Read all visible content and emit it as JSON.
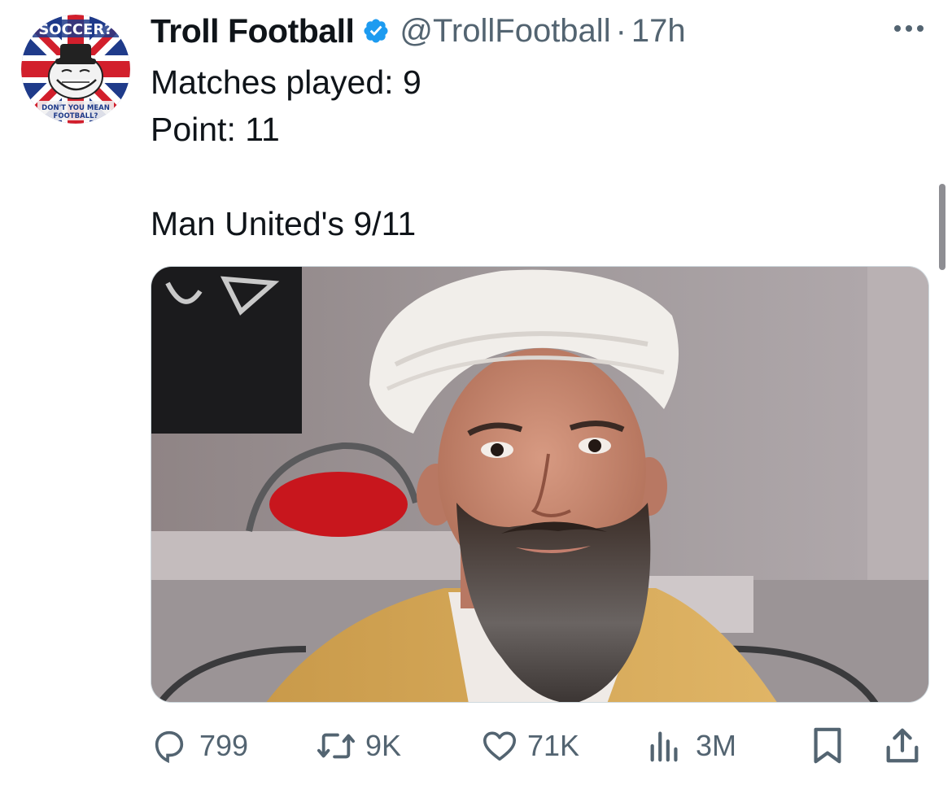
{
  "tweet": {
    "author": {
      "display_name": "Troll Football",
      "handle": "@TrollFootball",
      "verified": true,
      "avatar": {
        "icon": "troll-face-union-jack-avatar",
        "text_top": "SOCCER?",
        "text_bottom_1": "DON'T YOU MEAN",
        "text_bottom_2": "FOOTBALL?"
      }
    },
    "separator": "·",
    "time": "17h",
    "more_icon": "more-horizontal-icon",
    "text_lines": [
      "Matches played: 9",
      "Point: 11",
      "",
      "Man United's 9/11"
    ],
    "media": {
      "description_icon": "photo-edited-man-turban-beard"
    },
    "actions": {
      "replies": {
        "icon": "reply-icon",
        "count": "799"
      },
      "retweets": {
        "icon": "retweet-icon",
        "count": "9K"
      },
      "likes": {
        "icon": "heart-icon",
        "count": "71K"
      },
      "views": {
        "icon": "views-icon",
        "count": "3M"
      },
      "bookmark": {
        "icon": "bookmark-icon"
      },
      "share": {
        "icon": "share-icon"
      }
    },
    "colors": {
      "verified_blue": "#1d9bf0",
      "text": "#0f1419",
      "secondary": "#536471"
    }
  }
}
